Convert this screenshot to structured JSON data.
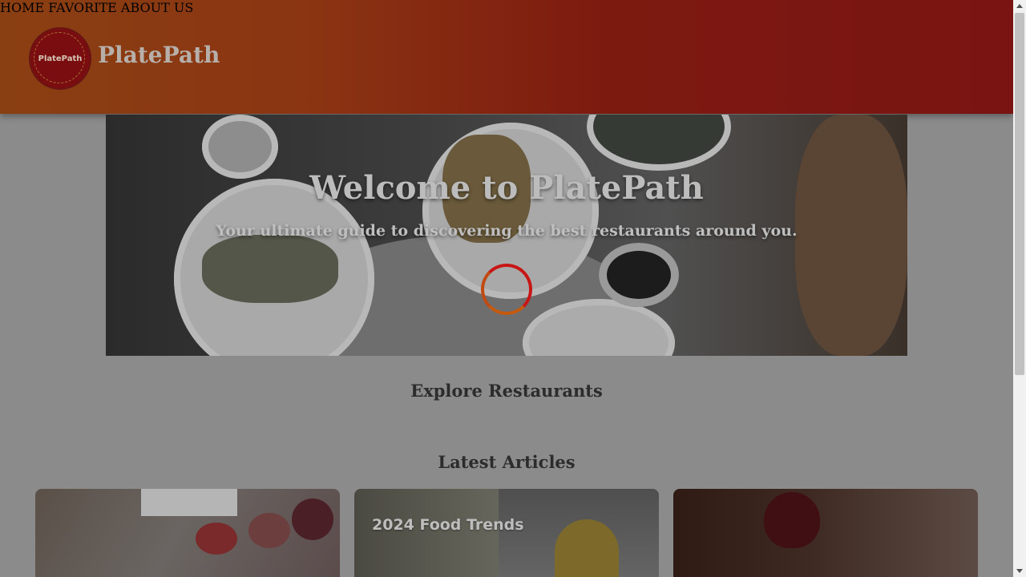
{
  "header": {
    "logo_text": "PlatePath",
    "brand": "PlatePath",
    "nav": [
      {
        "label": "HOME"
      },
      {
        "label": "FAVORITE"
      },
      {
        "label": "ABOUT US"
      }
    ]
  },
  "hero": {
    "title": "Welcome to PlatePath",
    "subtitle": "Your ultimate guide to discovering the best restaurants around you."
  },
  "sections": {
    "explore_title": "Explore Restaurants",
    "articles_title": "Latest Articles"
  },
  "articles": [
    {
      "label": ""
    },
    {
      "label": "2024 Food Trends"
    },
    {
      "label": ""
    }
  ],
  "colors": {
    "header_start": "#8a3f12",
    "header_end": "#791413",
    "spinner_primary": "#c81616",
    "spinner_secondary": "#c45a10"
  }
}
